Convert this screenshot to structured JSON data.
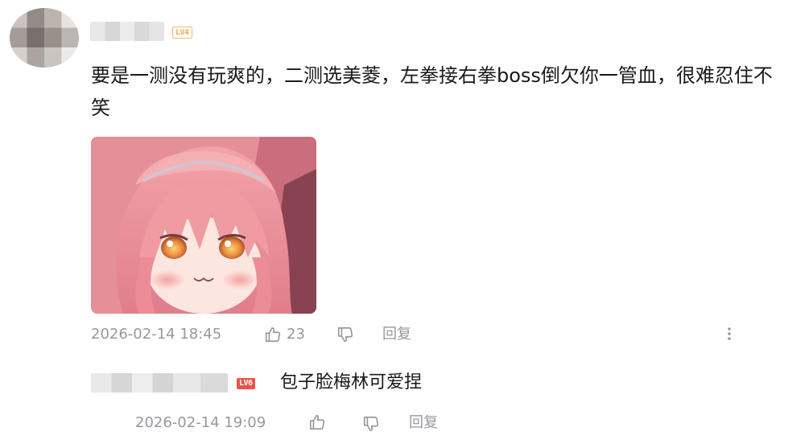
{
  "comment": {
    "level_badge": "LV4",
    "text": "要是一测没有玩爽的，二测选美菱，左拳接右拳boss倒欠你一管血，很难忍住不笑",
    "timestamp": "2026-02-14 18:45",
    "like_count": "23",
    "reply_label": "回复",
    "icons": {
      "like": "thumbs-up-icon",
      "dislike": "thumbs-down-icon",
      "more": "more-vertical-icon"
    }
  },
  "reply": {
    "level_badge": "LV6",
    "text": "包子脸梅林可爱捏",
    "timestamp": "2026-02-14 19:09",
    "reply_label": "回复"
  },
  "colors": {
    "meta_gray": "#9499a0",
    "lv4_orange": "#f5a852",
    "lv6_red": "#f0504a"
  }
}
